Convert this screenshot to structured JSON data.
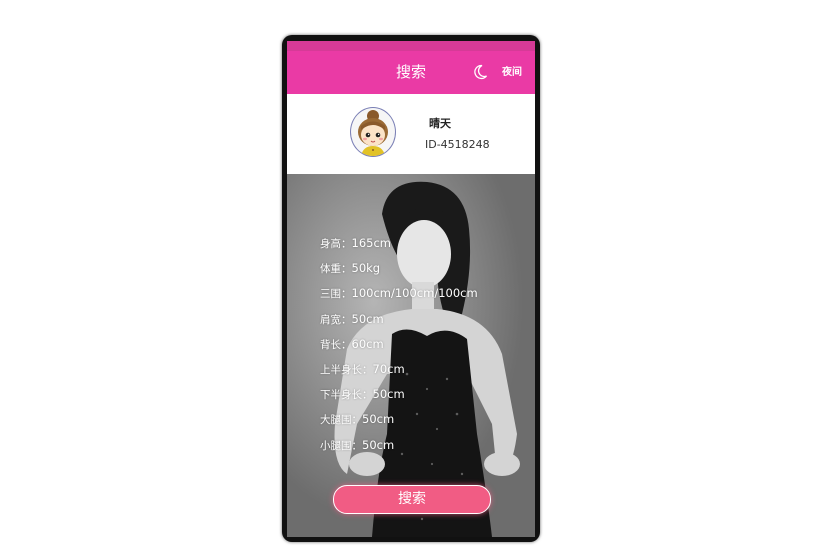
{
  "header": {
    "title": "搜索",
    "night_mode_label": "夜间"
  },
  "profile": {
    "username": "晴天",
    "user_id": "ID-4518248"
  },
  "measurements": [
    {
      "label": "身高：",
      "value": "165cm"
    },
    {
      "label": "体重：",
      "value": "50kg"
    },
    {
      "label": "三围：",
      "value": "100cm/100cm/100cm"
    },
    {
      "label": "肩宽：",
      "value": "50cm"
    },
    {
      "label": "背长：",
      "value": "60cm"
    },
    {
      "label": "上半身长：",
      "value": "70cm"
    },
    {
      "label": "下半身长：",
      "value": "50cm"
    },
    {
      "label": "大腿围：",
      "value": "50cm"
    },
    {
      "label": "小腿围：",
      "value": "50cm"
    }
  ],
  "search_button": {
    "label": "搜索"
  },
  "colors": {
    "header": "#ea3aa5",
    "button": "#f15c84"
  },
  "icons": {
    "night": "moon-icon"
  }
}
